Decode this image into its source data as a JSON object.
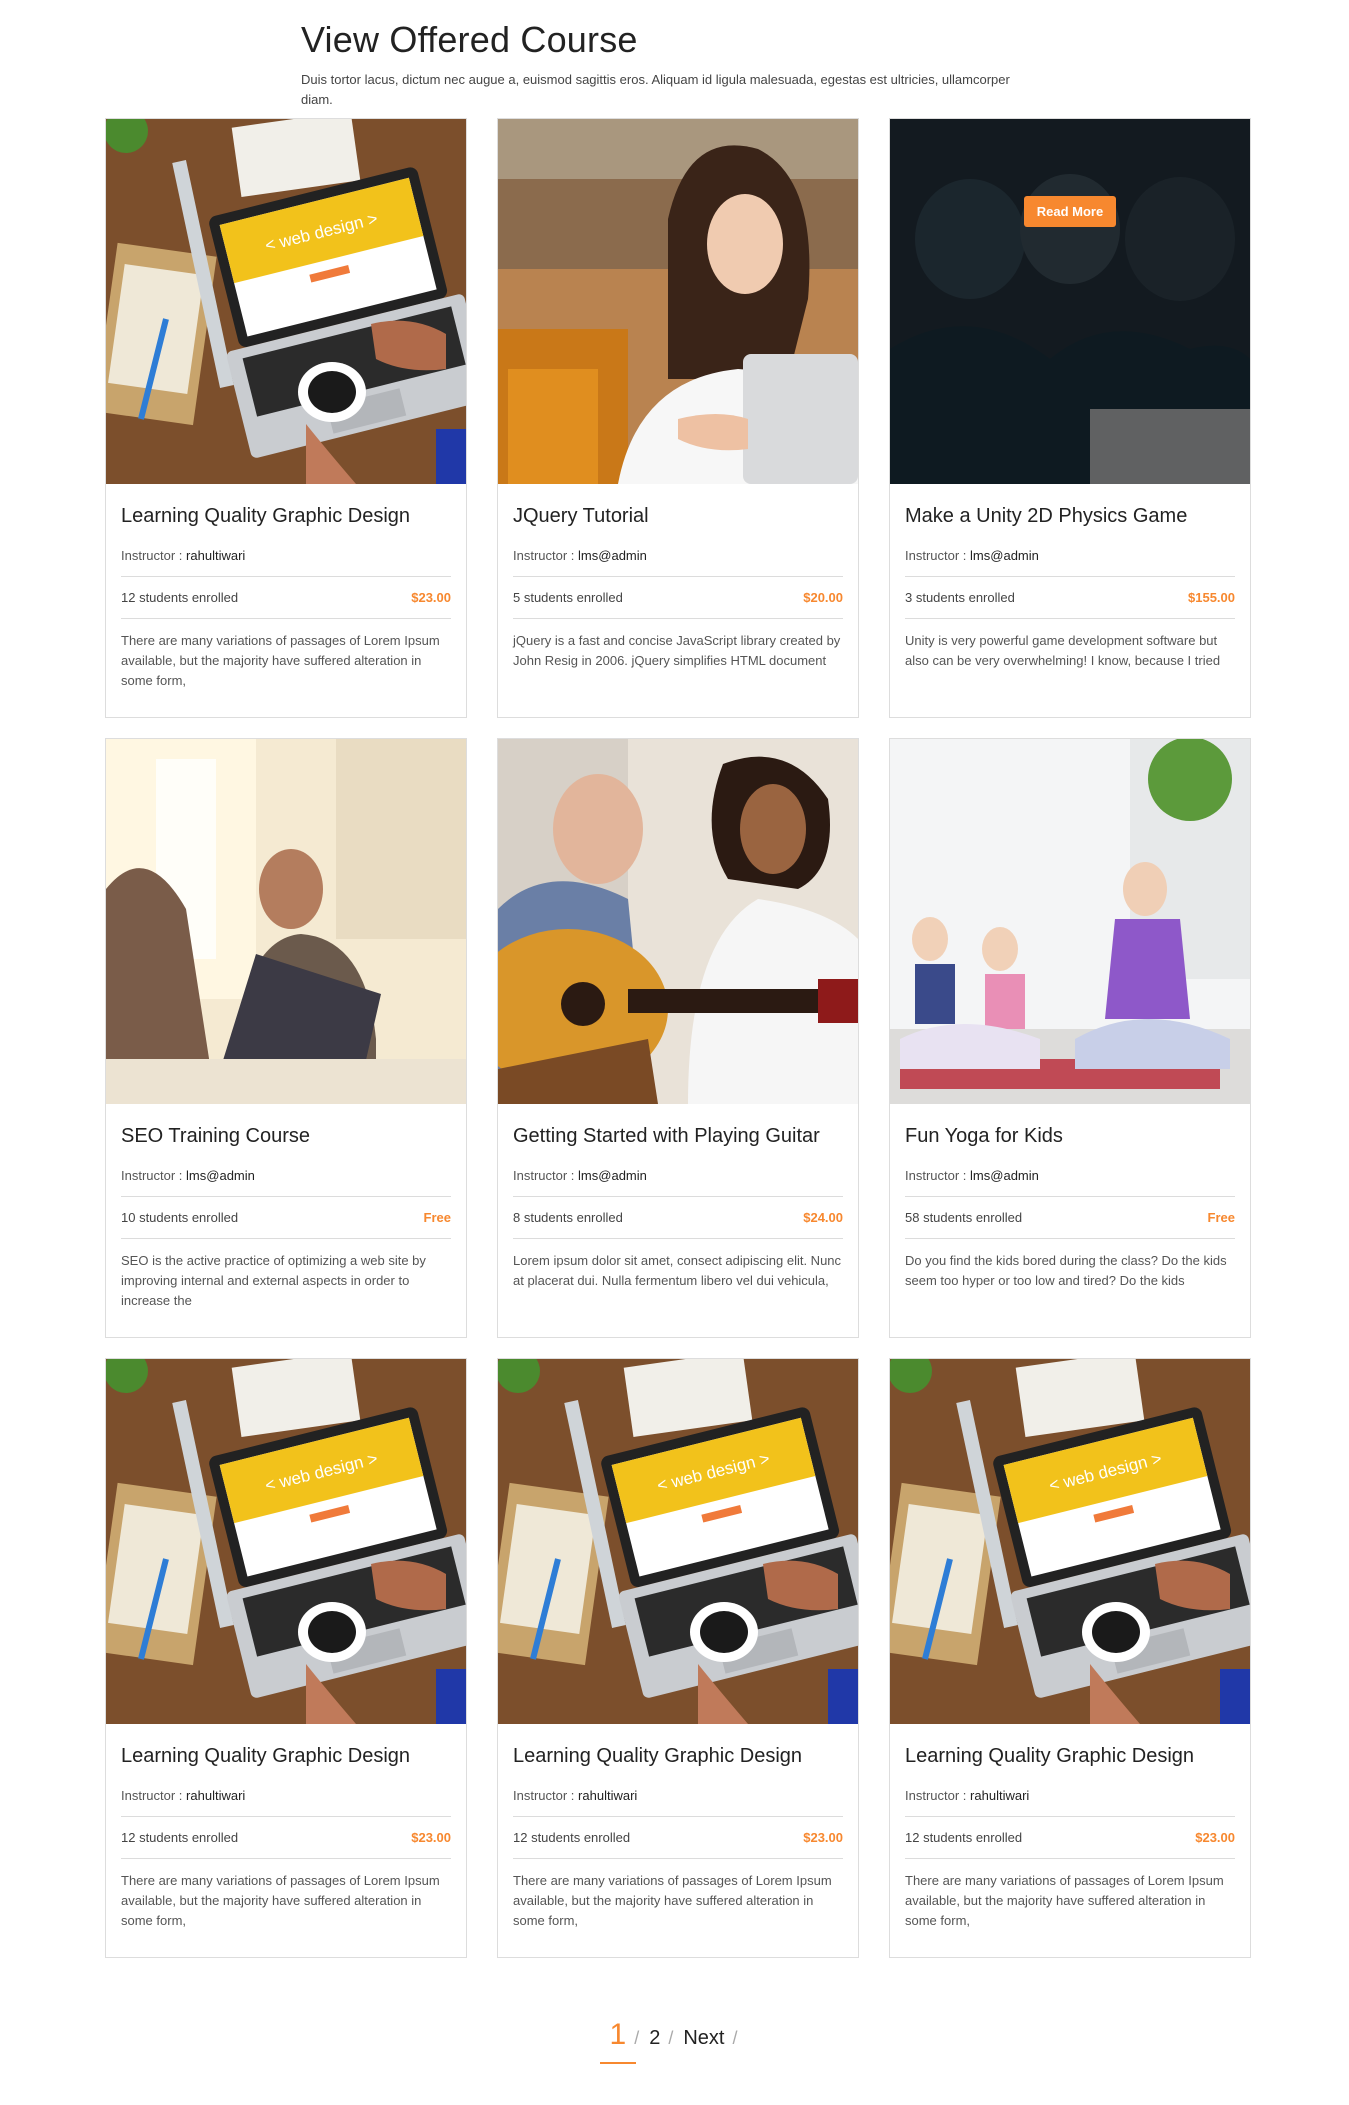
{
  "section": {
    "title": "View Offered Course",
    "description": "Duis tortor lacus, dictum nec augue a, euismod sagittis eros. Aliquam id ligula malesuada, egestas est ultricies, ullamcorper diam."
  },
  "colors": {
    "accent": "#f7882f",
    "border": "#dddddd",
    "text": "#333333"
  },
  "courses": [
    {
      "title": "Learning Quality Graphic Design",
      "instructor_label": "Instructor :",
      "instructor": "rahultiwari",
      "students": "12 students enrolled",
      "price": "$23.00",
      "description": "There are many variations of passages of Lorem Ipsum available, but the majority have suffered alteration in some form,",
      "image": "laptop-web-design-image"
    },
    {
      "title": "JQuery Tutorial",
      "instructor_label": "Instructor :",
      "instructor": "lms@admin",
      "students": "5 students enrolled",
      "price": "$20.00",
      "description": "jQuery is a fast and concise JavaScript library created by John Resig in 2006. jQuery simplifies HTML document",
      "image": "woman-laptop-image"
    },
    {
      "title": "Make a Unity 2D Physics Game",
      "instructor_label": "Instructor :",
      "instructor": "lms@admin",
      "students": "3 students enrolled",
      "price": "$155.00",
      "description": "Unity is very powerful game development software but also can be very overwhelming! I know, because I tried",
      "image": "students-group-image",
      "hover_button": "Read More"
    },
    {
      "title": "SEO Training Course",
      "instructor_label": "Instructor :",
      "instructor": "lms@admin",
      "students": "10 students enrolled",
      "price": "Free",
      "description": "SEO is the active practice of optimizing a web site by improving internal and external aspects in order to increase the",
      "image": "office-meeting-image"
    },
    {
      "title": "Getting Started with Playing Guitar",
      "instructor_label": "Instructor :",
      "instructor": "lms@admin",
      "students": "8 students enrolled",
      "price": "$24.00",
      "description": "Lorem ipsum dolor sit amet, consect adipiscing elit. Nunc at placerat dui. Nulla fermentum libero vel dui vehicula,",
      "image": "guitar-lesson-image"
    },
    {
      "title": "Fun Yoga for Kids",
      "instructor_label": "Instructor :",
      "instructor": "lms@admin",
      "students": "58 students enrolled",
      "price": "Free",
      "description": "Do you find the kids bored during the class? Do the kids seem too hyper or too low and tired? Do the kids",
      "image": "kids-yoga-image"
    },
    {
      "title": "Learning Quality Graphic Design",
      "instructor_label": "Instructor :",
      "instructor": "rahultiwari",
      "students": "12 students enrolled",
      "price": "$23.00",
      "description": "There are many variations of passages of Lorem Ipsum available, but the majority have suffered alteration in some form,",
      "image": "laptop-web-design-image"
    },
    {
      "title": "Learning Quality Graphic Design",
      "instructor_label": "Instructor :",
      "instructor": "rahultiwari",
      "students": "12 students enrolled",
      "price": "$23.00",
      "description": "There are many variations of passages of Lorem Ipsum available, but the majority have suffered alteration in some form,",
      "image": "laptop-web-design-image"
    },
    {
      "title": "Learning Quality Graphic Design",
      "instructor_label": "Instructor :",
      "instructor": "rahultiwari",
      "students": "12 students enrolled",
      "price": "$23.00",
      "description": "There are many variations of passages of Lorem Ipsum available, but the majority have suffered alteration in some form,",
      "image": "laptop-web-design-image"
    }
  ],
  "laptop_screen_text": "< web design >",
  "pagination": {
    "pages": [
      "1",
      "2"
    ],
    "current": "1",
    "next_label": "Next",
    "separator": "/"
  }
}
